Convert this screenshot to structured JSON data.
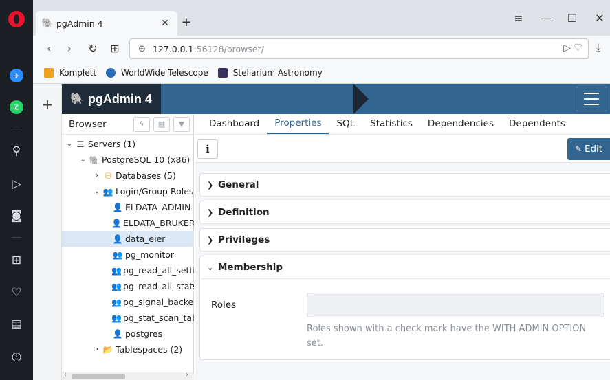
{
  "tab": {
    "title": "pgAdmin 4",
    "close": "✕"
  },
  "newtab": "+",
  "window": {
    "menu": "≡",
    "minimize": "—",
    "maximize": "☐",
    "close": "✕"
  },
  "nav": {
    "back": "‹",
    "forward": "›",
    "reload": "↻",
    "grid": "⊞"
  },
  "url": {
    "host": "127.0.0.1",
    "rest": ":56128/browser/",
    "actions": "▷ ♡",
    "download": "⤓"
  },
  "bookmarks": [
    {
      "label": "Komplett",
      "color": "#f0a020"
    },
    {
      "label": "WorldWide Telescope",
      "color": "#2a6db8"
    },
    {
      "label": "Stellarium Astronomy",
      "color": "#3a3060"
    }
  ],
  "left_strip": {
    "plus": "+"
  },
  "app": {
    "brand": "pgAdmin 4",
    "browser_panel": {
      "title": "Browser",
      "tools": [
        "ϟ",
        "▦",
        "▼"
      ],
      "tree": [
        {
          "label": "Servers (1)",
          "toggle": "⌄",
          "icon": "☰"
        },
        {
          "label": "PostgreSQL 10 (x86)",
          "toggle": "⌄",
          "icon": "🐘"
        },
        {
          "label": "Databases (5)",
          "toggle": "›",
          "icon": "⛁"
        },
        {
          "label": "Login/Group Roles",
          "toggle": "⌄",
          "icon": "👥"
        },
        {
          "label": "ELDATA_ADMIN",
          "toggle": "",
          "icon": "👤"
        },
        {
          "label": "ELDATA_BRUKER",
          "toggle": "",
          "icon": "👤"
        },
        {
          "label": "data_eier",
          "toggle": "",
          "icon": "👤"
        },
        {
          "label": "pg_monitor",
          "toggle": "",
          "icon": "👥"
        },
        {
          "label": "pg_read_all_settings",
          "toggle": "",
          "icon": "👥"
        },
        {
          "label": "pg_read_all_stats",
          "toggle": "",
          "icon": "👥"
        },
        {
          "label": "pg_signal_backend",
          "toggle": "",
          "icon": "👥"
        },
        {
          "label": "pg_stat_scan_tables",
          "toggle": "",
          "icon": "👥"
        },
        {
          "label": "postgres",
          "toggle": "",
          "icon": "👤"
        },
        {
          "label": "Tablespaces (2)",
          "toggle": "›",
          "icon": "📂"
        }
      ]
    },
    "tabs": [
      "Dashboard",
      "Properties",
      "SQL",
      "Statistics",
      "Dependencies",
      "Dependents"
    ],
    "active_tab": "Properties",
    "toolbar": {
      "info": "i",
      "edit": "Edit"
    },
    "sections": {
      "general": "General",
      "definition": "Definition",
      "privileges": "Privileges",
      "membership": "Membership"
    },
    "membership": {
      "roles_label": "Roles",
      "help": "Roles shown with a check mark have the WITH ADMIN OPTION set."
    }
  }
}
